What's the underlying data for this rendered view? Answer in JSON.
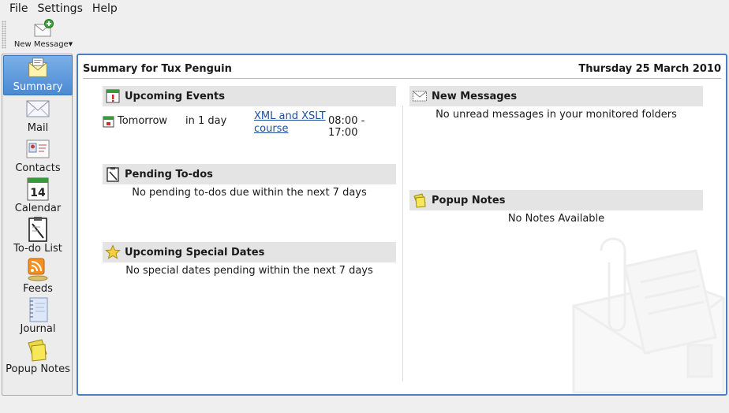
{
  "menu": {
    "file": "File",
    "settings": "Settings",
    "help": "Help"
  },
  "toolbar": {
    "new_message": "New Message"
  },
  "sidebar": {
    "items": [
      {
        "label": "Summary",
        "icon": "summary-icon",
        "active": true
      },
      {
        "label": "Mail",
        "icon": "mail-icon"
      },
      {
        "label": "Contacts",
        "icon": "contacts-icon"
      },
      {
        "label": "Calendar",
        "icon": "calendar-icon"
      },
      {
        "label": "To-do List",
        "icon": "todo-list-icon"
      },
      {
        "label": "Feeds",
        "icon": "feeds-icon"
      },
      {
        "label": "Journal",
        "icon": "journal-icon"
      },
      {
        "label": "Popup Notes",
        "icon": "popup-notes-icon"
      }
    ],
    "calendar_day": "14"
  },
  "summary": {
    "title": "Summary for Tux Penguin",
    "date": "Thursday 25 March 2010",
    "upcoming_events": {
      "title": "Upcoming Events",
      "events": [
        {
          "day": "Tomorrow",
          "relative": "in 1 day",
          "name": "XML and XSLT course",
          "time": "08:00 - 17:00"
        }
      ]
    },
    "pending_todos": {
      "title": "Pending To-dos",
      "message": "No pending to-dos due within the next 7 days"
    },
    "special_dates": {
      "title": "Upcoming Special Dates",
      "message": "No special dates pending within the next 7 days"
    },
    "new_messages": {
      "title": "New Messages",
      "message": "No unread messages in your monitored folders"
    },
    "popup_notes": {
      "title": "Popup Notes",
      "message": "No Notes Available"
    }
  },
  "colors": {
    "accent": "#4a7fc7",
    "active_item": "#5a95d8",
    "section_bg": "#e4e4e4",
    "link": "#1f4fa0"
  }
}
